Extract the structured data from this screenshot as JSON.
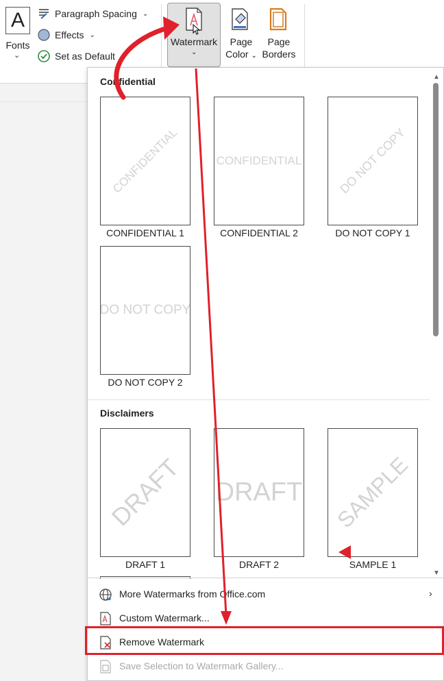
{
  "ribbon": {
    "fonts_label": "Fonts",
    "fonts_glyph": "A",
    "paragraph_spacing": "Paragraph Spacing",
    "effects": "Effects",
    "set_default": "Set as Default",
    "watermark": "Watermark",
    "page_color_line1": "Page",
    "page_color_line2": "Color",
    "page_borders_line1": "Page",
    "page_borders_line2": "Borders"
  },
  "gallery": {
    "sections": [
      {
        "title": "Confidential",
        "items": [
          {
            "caption": "CONFIDENTIAL 1",
            "mark": "CONFIDENTIAL",
            "style": "diagonal"
          },
          {
            "caption": "CONFIDENTIAL 2",
            "mark": "CONFIDENTIAL",
            "style": "horizontal"
          },
          {
            "caption": "DO NOT COPY 1",
            "mark": "DO NOT COPY",
            "style": "diagonal"
          },
          {
            "caption": "DO NOT COPY 2",
            "mark": "DO NOT COPY",
            "style": "horizontal"
          }
        ]
      },
      {
        "title": "Disclaimers",
        "items": [
          {
            "caption": "DRAFT 1",
            "mark": "DRAFT",
            "style": "diagonal"
          },
          {
            "caption": "DRAFT 2",
            "mark": "DRAFT",
            "style": "horizontal"
          },
          {
            "caption": "SAMPLE 1",
            "mark": "SAMPLE",
            "style": "diagonal"
          }
        ]
      }
    ]
  },
  "menu": {
    "more_watermarks": "More Watermarks from Office.com",
    "custom_watermark": "Custom Watermark...",
    "remove_watermark": "Remove Watermark",
    "save_selection": "Save Selection to Watermark Gallery..."
  },
  "colors": {
    "annotation": "#e0202a",
    "watermark_text": "#d3d3d3",
    "page_color_accent": "#4472c4",
    "page_borders_accent": "#d97b1f"
  }
}
